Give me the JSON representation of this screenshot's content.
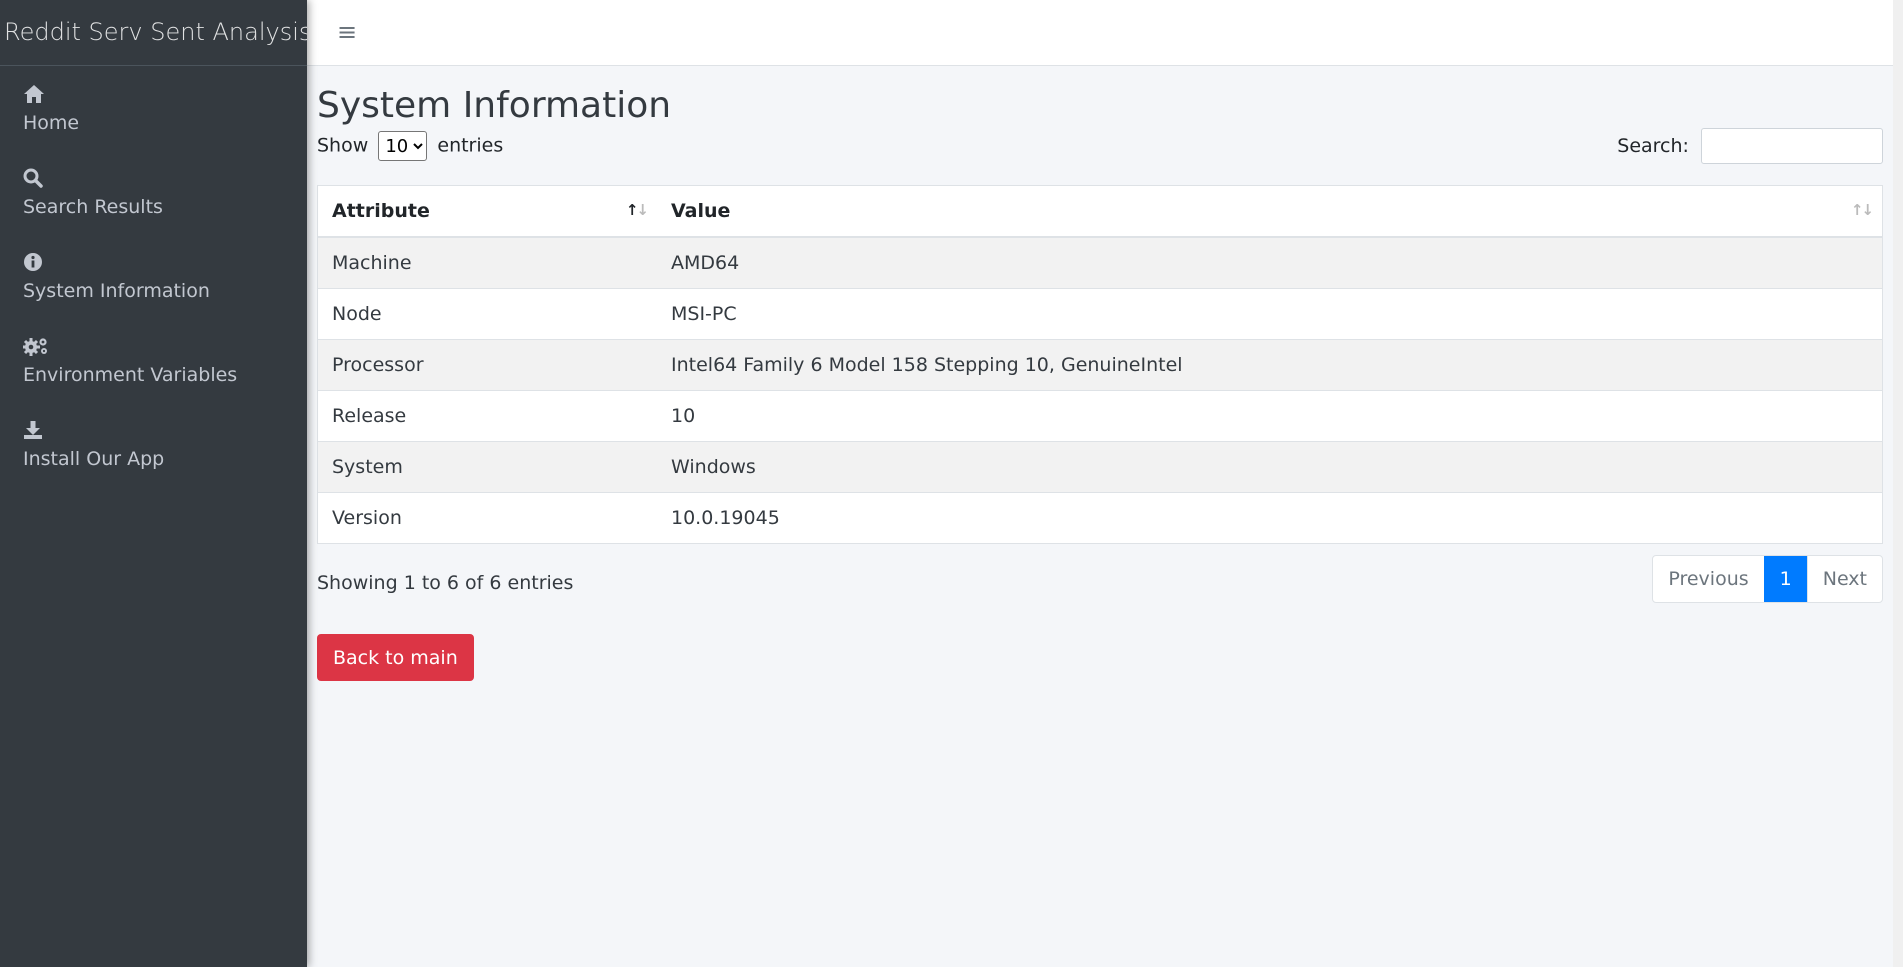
{
  "brand": "Reddit Serv Sent Analysis",
  "sidebar": {
    "items": [
      {
        "icon": "home-icon",
        "label": "Home"
      },
      {
        "icon": "search-icon",
        "label": "Search Results"
      },
      {
        "icon": "info-icon",
        "label": "System Information"
      },
      {
        "icon": "gears-icon",
        "label": "Environment Variables"
      },
      {
        "icon": "download-icon",
        "label": "Install Our App"
      }
    ]
  },
  "header": {
    "menu_icon": "≡"
  },
  "main": {
    "title": "System Information",
    "length": {
      "prefix": "Show",
      "selected": "10",
      "suffix": "entries"
    },
    "search": {
      "label": "Search:",
      "value": ""
    },
    "table": {
      "headers": [
        "Attribute",
        "Value"
      ],
      "rows": [
        [
          "Machine",
          "AMD64"
        ],
        [
          "Node",
          "MSI-PC"
        ],
        [
          "Processor",
          "Intel64 Family 6 Model 158 Stepping 10, GenuineIntel"
        ],
        [
          "Release",
          "10"
        ],
        [
          "System",
          "Windows"
        ],
        [
          "Version",
          "10.0.19045"
        ]
      ]
    },
    "info": "Showing 1 to 6 of 6 entries",
    "pagination": {
      "previous": "Previous",
      "current": "1",
      "next": "Next"
    },
    "back_button": "Back to main"
  },
  "colors": {
    "sidebar": "#343a40",
    "accent": "#007bff",
    "danger": "#dc3545"
  }
}
